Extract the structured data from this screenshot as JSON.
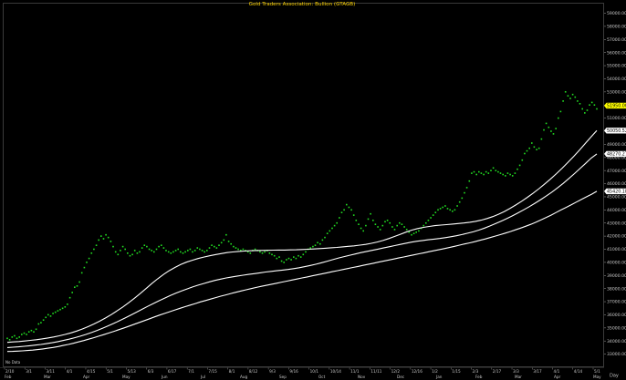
{
  "chart_data": {
    "type": "scatter",
    "title": "Gold Traders Association: Bullion (GTAGB)",
    "ylim": [
      32000,
      59800
    ],
    "y_ticks": [
      33000,
      34000,
      35000,
      36000,
      37000,
      38000,
      39000,
      40000,
      41000,
      42000,
      43000,
      44000,
      45000,
      46000,
      47000,
      48000,
      49000,
      50000,
      51000,
      52000,
      53000,
      54000,
      55000,
      56000,
      57000,
      58000,
      59000
    ],
    "y_tick_labels": [
      "33000.00",
      "34000.00",
      "35000.00",
      "36000.00",
      "37000.00",
      "38000.00",
      "39000.00",
      "40000.00",
      "41000.00",
      "42000.00",
      "43000.00",
      "44000.00",
      "45000.00",
      "46000.00",
      "47000.00",
      "48000.00",
      "49000.00",
      "50000.00",
      "51000.00",
      "52000.00",
      "53000.00",
      "54000.00",
      "55000.00",
      "56000.00",
      "57000.00",
      "58000.00",
      "59000.00"
    ],
    "price_badges": [
      {
        "value": 51950,
        "label": "51950.00",
        "color": "#ffff00"
      },
      {
        "value": 50050,
        "label": "50050.52",
        "color": "#ffffff"
      },
      {
        "value": 48270,
        "label": "48270.27",
        "color": "#ffffff"
      },
      {
        "value": 45420,
        "label": "45420.18",
        "color": "#ffffff"
      }
    ],
    "x_month_labels": [
      "Feb",
      "Mar",
      "Apr",
      "May",
      "Jun",
      "Jul",
      "Aug",
      "Sep",
      "Oct",
      "Nov",
      "Dec",
      "Jan",
      "Feb",
      "Mar",
      "Apr",
      "May"
    ],
    "x_week_labels": [
      "2/10",
      "3/1",
      "3/11",
      "4/1",
      "4/15",
      "5/1",
      "5/13",
      "6/3",
      "6/17",
      "7/1",
      "7/15",
      "8/1",
      "8/12",
      "9/3",
      "9/16",
      "10/1",
      "10/14",
      "11/1",
      "11/11",
      "12/2",
      "12/16",
      "1/2",
      "1/15",
      "2/3",
      "2/17",
      "3/3",
      "3/17",
      "4/1",
      "4/14",
      "5/1"
    ],
    "axis_unit_label": "Day",
    "note_label": "No Data",
    "series": [
      {
        "style": "dots",
        "color": "#22dd22",
        "values": [
          34200,
          34100,
          34300,
          34400,
          34200,
          34300,
          34500,
          34600,
          34500,
          34700,
          34800,
          34700,
          34900,
          35300,
          35400,
          35600,
          35800,
          36000,
          35900,
          36100,
          36200,
          36300,
          36400,
          36500,
          36600,
          36800,
          37300,
          37700,
          38100,
          38200,
          38500,
          39200,
          39600,
          40000,
          40300,
          40700,
          41000,
          41300,
          41700,
          42000,
          41800,
          42100,
          41900,
          41600,
          41200,
          40800,
          40600,
          40900,
          41200,
          41000,
          40700,
          40500,
          40600,
          40900,
          40700,
          40800,
          41100,
          41300,
          41200,
          41000,
          40900,
          40800,
          41000,
          41200,
          41300,
          41100,
          40900,
          40800,
          40700,
          40800,
          40900,
          41000,
          40800,
          40700,
          40800,
          40900,
          41000,
          40800,
          40900,
          41100,
          41000,
          40900,
          40800,
          40900,
          41100,
          41300,
          41200,
          41100,
          41300,
          41500,
          41700,
          42100,
          41600,
          41400,
          41200,
          41100,
          41000,
          40900,
          41000,
          40900,
          40800,
          40700,
          40900,
          41000,
          40900,
          40800,
          40700,
          40800,
          40900,
          40700,
          40600,
          40500,
          40300,
          40400,
          40100,
          40000,
          40200,
          40300,
          40200,
          40400,
          40300,
          40500,
          40400,
          40600,
          40800,
          41000,
          41100,
          41200,
          41300,
          41500,
          41400,
          41700,
          41900,
          42200,
          42400,
          42600,
          42800,
          43000,
          43400,
          43800,
          44000,
          44400,
          44200,
          44000,
          43600,
          43200,
          42900,
          42600,
          42400,
          42800,
          43300,
          43700,
          43200,
          42900,
          42700,
          42500,
          42800,
          43100,
          43200,
          43000,
          42700,
          42500,
          42800,
          43000,
          42900,
          42700,
          42500,
          42300,
          42100,
          42200,
          42300,
          42400,
          42600,
          42800,
          43000,
          43200,
          43400,
          43600,
          43800,
          44000,
          44100,
          44200,
          44300,
          44100,
          44000,
          43900,
          44000,
          44300,
          44600,
          44900,
          45300,
          45700,
          46200,
          46800,
          46900,
          46700,
          46900,
          46800,
          46700,
          46900,
          46800,
          47000,
          47200,
          47000,
          46900,
          46800,
          46700,
          46600,
          46800,
          46700,
          46600,
          46800,
          47100,
          47400,
          47800,
          48300,
          48500,
          48700,
          49100,
          48800,
          48600,
          48700,
          49400,
          50100,
          50600,
          50300,
          50000,
          49800,
          50200,
          51000,
          51500,
          52300,
          53000,
          52700,
          52500,
          52800,
          52600,
          52300,
          52100,
          51700,
          51400,
          51600,
          52000,
          52200,
          52000,
          51700
        ]
      },
      {
        "style": "line",
        "color": "#ffffff",
        "values": [
          33900,
          33930,
          33960,
          34000,
          34050,
          34100,
          34160,
          34230,
          34310,
          34400,
          34500,
          34620,
          34760,
          34920,
          35100,
          35300,
          35520,
          35760,
          36020,
          36300,
          36600,
          36920,
          37260,
          37620,
          38000,
          38380,
          38740,
          39070,
          39360,
          39610,
          39830,
          40010,
          40160,
          40290,
          40400,
          40500,
          40590,
          40670,
          40740,
          40790,
          40830,
          40860,
          40880,
          40900,
          40910,
          40920,
          40930,
          40940,
          40940,
          40950,
          40960,
          40980,
          41000,
          41020,
          41050,
          41080,
          41110,
          41140,
          41180,
          41220,
          41260,
          41310,
          41370,
          41450,
          41550,
          41670,
          41810,
          41970,
          42140,
          42310,
          42460,
          42580,
          42670,
          42740,
          42800,
          42840,
          42880,
          42920,
          42960,
          43000,
          43060,
          43130,
          43220,
          43340,
          43490,
          43670,
          43880,
          44120,
          44380,
          44660,
          44960,
          45280,
          45620,
          45980,
          46360,
          46760,
          47180,
          47620,
          48080,
          48560,
          49060,
          49560,
          50050
        ]
      },
      {
        "style": "line",
        "color": "#ffffff",
        "values": [
          33500,
          33530,
          33560,
          33600,
          33640,
          33690,
          33740,
          33800,
          33870,
          33950,
          34040,
          34140,
          34250,
          34370,
          34500,
          34650,
          34810,
          34980,
          35160,
          35350,
          35550,
          35760,
          35980,
          36200,
          36420,
          36640,
          36860,
          37070,
          37270,
          37460,
          37640,
          37810,
          37970,
          38120,
          38260,
          38390,
          38510,
          38620,
          38720,
          38810,
          38890,
          38960,
          39020,
          39080,
          39140,
          39200,
          39260,
          39310,
          39360,
          39410,
          39460,
          39520,
          39590,
          39670,
          39760,
          39860,
          39970,
          40090,
          40210,
          40330,
          40440,
          40540,
          40640,
          40740,
          40830,
          40920,
          41010,
          41100,
          41190,
          41280,
          41370,
          41460,
          41540,
          41610,
          41670,
          41720,
          41770,
          41820,
          41880,
          41950,
          42030,
          42120,
          42220,
          42330,
          42460,
          42610,
          42780,
          42960,
          43150,
          43350,
          43560,
          43780,
          44010,
          44250,
          44510,
          44780,
          45060,
          45360,
          45680,
          46020,
          46380,
          46760,
          47150,
          47550,
          47950,
          48270
        ]
      },
      {
        "style": "line",
        "color": "#ffffff",
        "values": [
          33200,
          33210,
          33230,
          33250,
          33280,
          33310,
          33350,
          33400,
          33450,
          33510,
          33580,
          33660,
          33740,
          33830,
          33930,
          34030,
          34140,
          34250,
          34370,
          34490,
          34610,
          34740,
          34870,
          35000,
          35140,
          35280,
          35420,
          35560,
          35700,
          35840,
          35980,
          36110,
          36240,
          36370,
          36500,
          36620,
          36740,
          36860,
          36980,
          37090,
          37200,
          37310,
          37420,
          37520,
          37620,
          37720,
          37820,
          37910,
          38000,
          38090,
          38170,
          38250,
          38330,
          38410,
          38490,
          38570,
          38650,
          38730,
          38810,
          38890,
          38970,
          39050,
          39130,
          39210,
          39290,
          39370,
          39450,
          39530,
          39610,
          39690,
          39770,
          39850,
          39930,
          40010,
          40090,
          40170,
          40250,
          40330,
          40410,
          40490,
          40570,
          40650,
          40730,
          40810,
          40890,
          40970,
          41050,
          41130,
          41220,
          41310,
          41400,
          41490,
          41580,
          41680,
          41780,
          41890,
          42000,
          42110,
          42230,
          42350,
          42480,
          42610,
          42750,
          42900,
          43060,
          43230,
          43410,
          43600,
          43800,
          44000,
          44200,
          44400,
          44600,
          44800,
          45000,
          45200,
          45420
        ]
      }
    ]
  }
}
